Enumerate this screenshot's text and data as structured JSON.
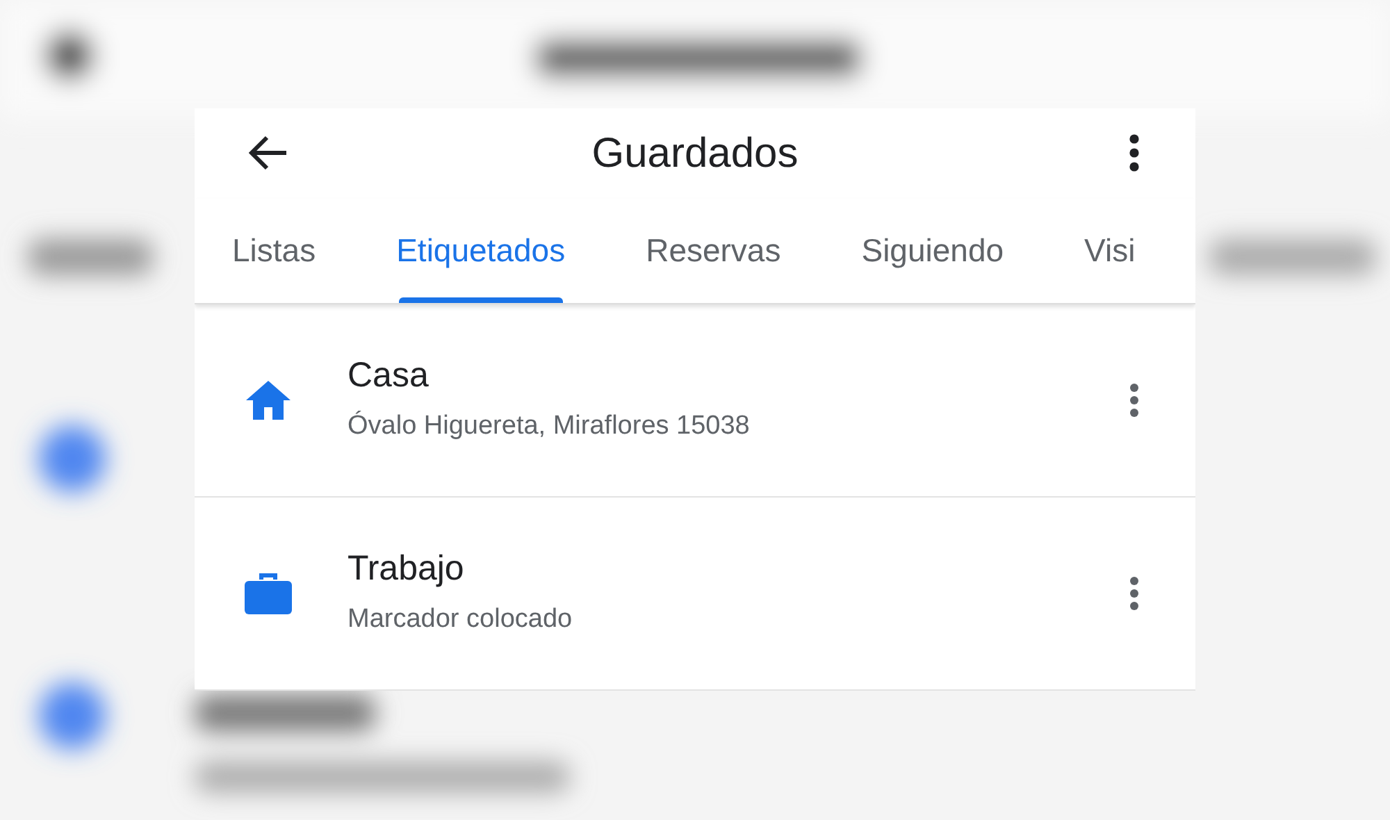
{
  "header": {
    "title": "Guardados"
  },
  "tabs": [
    {
      "label": "Listas",
      "selected": false
    },
    {
      "label": "Etiquetados",
      "selected": true
    },
    {
      "label": "Reservas",
      "selected": false
    },
    {
      "label": "Siguiendo",
      "selected": false
    },
    {
      "label": "Visi",
      "selected": false
    }
  ],
  "places": [
    {
      "kind": "home",
      "name": "Casa",
      "address": "Óvalo Higuereta, Miraflores 15038"
    },
    {
      "kind": "work",
      "name": "Trabajo",
      "address": "Marcador colocado"
    }
  ]
}
